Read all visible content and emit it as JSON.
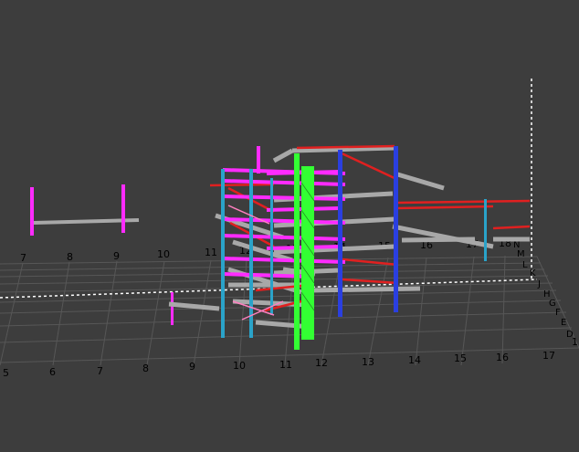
{
  "viewport": {
    "background": "#3d3d3d",
    "grid_color": "#5a5a5a",
    "axis_dash_color": "#ffffff"
  },
  "grid_labels": {
    "far_row": [
      "7",
      "8",
      "9",
      "10",
      "11",
      "12",
      "13",
      "14",
      "15",
      "16",
      "17",
      "18"
    ],
    "near_row": [
      "5",
      "6",
      "7",
      "8",
      "9",
      "10",
      "11",
      "12",
      "13",
      "14",
      "15",
      "16",
      "17"
    ],
    "right_col": [
      "N",
      "M",
      "L",
      "K",
      "J",
      "H",
      "G",
      "F",
      "E",
      "D"
    ],
    "near_row_end": "1"
  },
  "colors": {
    "magenta": "#ff2bff",
    "cyan": "#2aa3c9",
    "green": "#33ff33",
    "blue": "#2a3fe0",
    "red": "#e02020",
    "gray": "#a8a8a8",
    "pink": "#ff7fbf"
  }
}
